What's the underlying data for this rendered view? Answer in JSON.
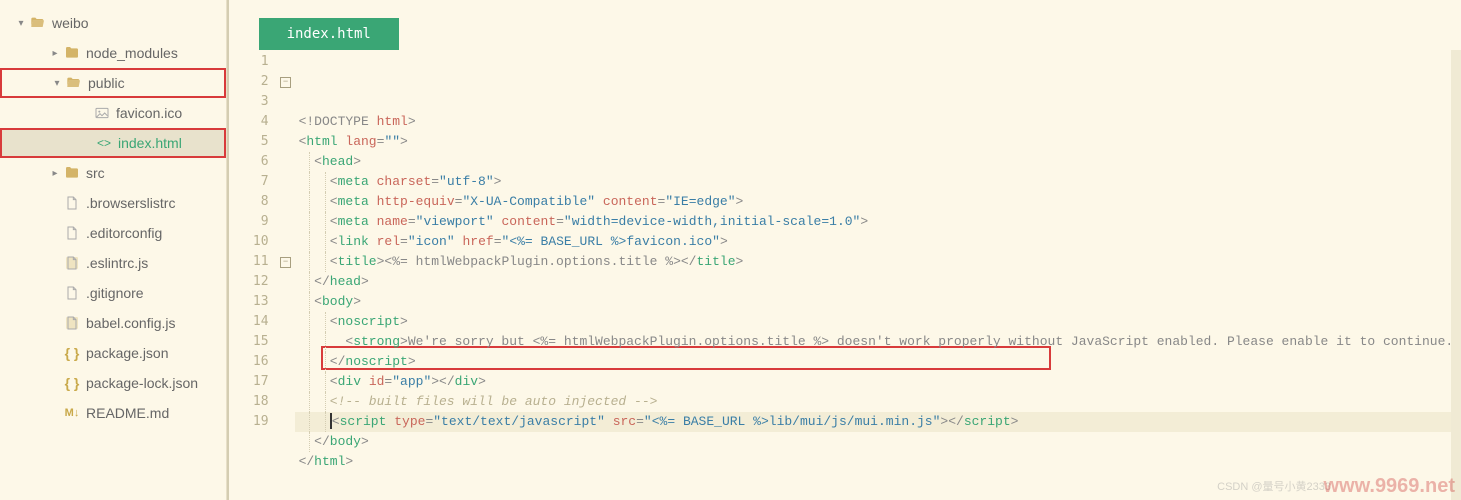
{
  "sidebar": {
    "root": {
      "name": "weibo",
      "icon": "folder-open",
      "expanded": true
    },
    "items": [
      {
        "name": "node_modules",
        "icon": "folder",
        "depth": 1,
        "chevron": "right"
      },
      {
        "name": "public",
        "icon": "folder-open",
        "depth": 1,
        "chevron": "down",
        "boxed": true
      },
      {
        "name": "favicon.ico",
        "icon": "image",
        "depth": 2
      },
      {
        "name": "index.html",
        "icon": "code",
        "depth": 2,
        "active": true,
        "selected": true,
        "boxed": true
      },
      {
        "name": "src",
        "icon": "folder",
        "depth": 1,
        "chevron": "right"
      },
      {
        "name": ".browserslistrc",
        "icon": "file",
        "depth": 1
      },
      {
        "name": ".editorconfig",
        "icon": "file",
        "depth": 1
      },
      {
        "name": ".eslintrc.js",
        "icon": "js",
        "depth": 1
      },
      {
        "name": ".gitignore",
        "icon": "file",
        "depth": 1
      },
      {
        "name": "babel.config.js",
        "icon": "js",
        "depth": 1
      },
      {
        "name": "package.json",
        "icon": "json",
        "depth": 1
      },
      {
        "name": "package-lock.json",
        "icon": "json",
        "depth": 1
      },
      {
        "name": "README.md",
        "icon": "md",
        "depth": 1
      }
    ]
  },
  "editor": {
    "tab": "index.html",
    "lines": [
      {
        "n": 1,
        "fold": "",
        "html": "<span class='c-punc'>&lt;!</span><span class='c-doctype'>DOCTYPE </span><span class='c-doctype-kw'>html</span><span class='c-punc'>&gt;</span>",
        "indent": 0
      },
      {
        "n": 2,
        "fold": "-",
        "html": "<span class='c-punc'>&lt;</span><span class='c-tag'>html</span> <span class='c-attr'>lang</span><span class='c-punc'>=</span><span class='c-str'>\"\"</span><span class='c-punc'>&gt;</span>",
        "indent": 0
      },
      {
        "n": 3,
        "fold": "",
        "html": "  <span class='c-punc'>&lt;</span><span class='c-tag'>head</span><span class='c-punc'>&gt;</span>",
        "indent": 1
      },
      {
        "n": 4,
        "fold": "",
        "html": "    <span class='c-punc'>&lt;</span><span class='c-tag'>meta</span> <span class='c-attr'>charset</span><span class='c-punc'>=</span><span class='c-str'>\"utf-8\"</span><span class='c-punc'>&gt;</span>",
        "indent": 2
      },
      {
        "n": 5,
        "fold": "",
        "html": "    <span class='c-punc'>&lt;</span><span class='c-tag'>meta</span> <span class='c-attr'>http-equiv</span><span class='c-punc'>=</span><span class='c-str'>\"X-UA-Compatible\"</span> <span class='c-attr'>content</span><span class='c-punc'>=</span><span class='c-str'>\"IE=edge\"</span><span class='c-punc'>&gt;</span>",
        "indent": 2
      },
      {
        "n": 6,
        "fold": "",
        "html": "    <span class='c-punc'>&lt;</span><span class='c-tag'>meta</span> <span class='c-attr'>name</span><span class='c-punc'>=</span><span class='c-str'>\"viewport\"</span> <span class='c-attr'>content</span><span class='c-punc'>=</span><span class='c-str'>\"width=device-width,initial-scale=1.0\"</span><span class='c-punc'>&gt;</span>",
        "indent": 2
      },
      {
        "n": 7,
        "fold": "",
        "html": "    <span class='c-punc'>&lt;</span><span class='c-tag'>link</span> <span class='c-attr'>rel</span><span class='c-punc'>=</span><span class='c-str'>\"icon\"</span> <span class='c-attr'>href</span><span class='c-punc'>=</span><span class='c-str'>\"</span><span class='c-tpl'>&lt;%= BASE_URL %&gt;</span><span class='c-str'>favicon.ico\"</span><span class='c-punc'>&gt;</span>",
        "indent": 2
      },
      {
        "n": 8,
        "fold": "",
        "html": "    <span class='c-punc'>&lt;</span><span class='c-tag'>title</span><span class='c-punc'>&gt;</span><span class='c-text'>&lt;%= htmlWebpackPlugin.options.title %&gt;</span><span class='c-punc'>&lt;/</span><span class='c-tag'>title</span><span class='c-punc'>&gt;</span>",
        "indent": 2
      },
      {
        "n": 9,
        "fold": "",
        "html": "  <span class='c-punc'>&lt;/</span><span class='c-tag'>head</span><span class='c-punc'>&gt;</span>",
        "indent": 1
      },
      {
        "n": 10,
        "fold": "",
        "html": "  <span class='c-punc'>&lt;</span><span class='c-tag'>body</span><span class='c-punc'>&gt;</span>",
        "indent": 1
      },
      {
        "n": 11,
        "fold": "-",
        "html": "    <span class='c-punc'>&lt;</span><span class='c-tag'>noscript</span><span class='c-punc'>&gt;</span>",
        "indent": 2
      },
      {
        "n": 12,
        "fold": "",
        "html": "      <span class='c-punc'>&lt;</span><span class='c-tag'>strong</span><span class='c-punc'>&gt;</span><span class='c-text'>We're sorry but &lt;%= htmlWebpackPlugin.options.title %&gt; doesn't work properly without JavaScript enabled. Please enable it to continue.</span><span class='c-punc'>&lt;</span>",
        "indent": 2
      },
      {
        "n": 13,
        "fold": "",
        "html": "    <span class='c-punc'>&lt;/</span><span class='c-tag'>noscript</span><span class='c-punc'>&gt;</span>",
        "indent": 2
      },
      {
        "n": 14,
        "fold": "",
        "html": "    <span class='c-punc'>&lt;</span><span class='c-tag'>div</span> <span class='c-attr'>id</span><span class='c-punc'>=</span><span class='c-str'>\"app\"</span><span class='c-punc'>&gt;&lt;/</span><span class='c-tag'>div</span><span class='c-punc'>&gt;</span>",
        "indent": 2
      },
      {
        "n": 15,
        "fold": "",
        "html": "    <span class='c-comment'>&lt;!-- built files will be auto injected --&gt;</span>",
        "indent": 2
      },
      {
        "n": 16,
        "fold": "",
        "hl": true,
        "html": "    <span class='cursor'></span><span class='c-punc'>&lt;</span><span class='c-tag'>script</span> <span class='c-attr'>type</span><span class='c-punc'>=</span><span class='c-str'>\"text/text/javascript\"</span> <span class='c-attr'>src</span><span class='c-punc'>=</span><span class='c-str'>\"</span><span class='c-tpl'>&lt;%= BASE_URL %&gt;</span><span class='c-str'>lib/mui/js/mui.min.js\"</span><span class='c-punc'>&gt;&lt;/</span><span class='c-tag'>script</span><span class='c-punc'>&gt;</span>",
        "indent": 2
      },
      {
        "n": 17,
        "fold": "",
        "html": "  <span class='c-punc'>&lt;/</span><span class='c-tag'>body</span><span class='c-punc'>&gt;</span>",
        "indent": 1
      },
      {
        "n": 18,
        "fold": "",
        "html": "<span class='c-punc'>&lt;/</span><span class='c-tag'>html</span><span class='c-punc'>&gt;</span>",
        "indent": 0
      },
      {
        "n": 19,
        "fold": "",
        "html": "",
        "indent": 0
      }
    ]
  },
  "watermark": {
    "main": "www.9969.net",
    "sub": "CSDN @量号小黄2333"
  }
}
